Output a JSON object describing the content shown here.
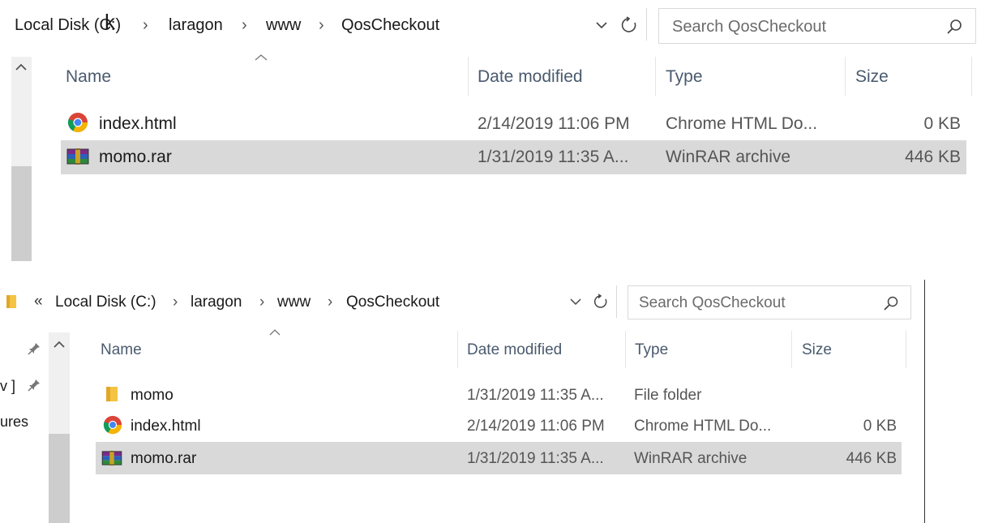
{
  "top": {
    "address": {
      "segments": [
        "Local Disk (C:)",
        "laragon",
        "www",
        "QosCheckout"
      ],
      "separator": "›",
      "cursor_glyph": "k"
    },
    "search_placeholder": "Search QosCheckout",
    "columns": {
      "name": "Name",
      "date": "Date modified",
      "type": "Type",
      "size": "Size"
    },
    "files": [
      {
        "name": "index.html",
        "date": "2/14/2019 11:06 PM",
        "type": "Chrome HTML Do...",
        "size": "0 KB",
        "icon": "chrome-icon",
        "selected": false
      },
      {
        "name": "momo.rar",
        "date": "1/31/2019 11:35 A...",
        "type": "WinRAR archive",
        "size": "446 KB",
        "icon": "winrar-icon",
        "selected": true
      }
    ]
  },
  "bottom": {
    "address": {
      "overflow": "«",
      "segments": [
        "Local Disk (C:)",
        "laragon",
        "www",
        "QosCheckout"
      ],
      "separator": "›"
    },
    "search_placeholder": "Search QosCheckout",
    "sidebar_fragments": [
      "v ]",
      "ures"
    ],
    "columns": {
      "name": "Name",
      "date": "Date modified",
      "type": "Type",
      "size": "Size"
    },
    "files": [
      {
        "name": "momo",
        "date": "1/31/2019 11:35 A...",
        "type": "File folder",
        "size": "",
        "icon": "folder-icon",
        "selected": false
      },
      {
        "name": "index.html",
        "date": "2/14/2019 11:06 PM",
        "type": "Chrome HTML Do...",
        "size": "0 KB",
        "icon": "chrome-icon",
        "selected": false
      },
      {
        "name": "momo.rar",
        "date": "1/31/2019 11:35 A...",
        "type": "WinRAR archive",
        "size": "446 KB",
        "icon": "winrar-icon",
        "selected": true
      }
    ]
  },
  "colors": {
    "selection": "#d9d9d9",
    "folder": "#f5c342",
    "chrome_red": "#db4437",
    "chrome_blue": "#4285f4"
  }
}
